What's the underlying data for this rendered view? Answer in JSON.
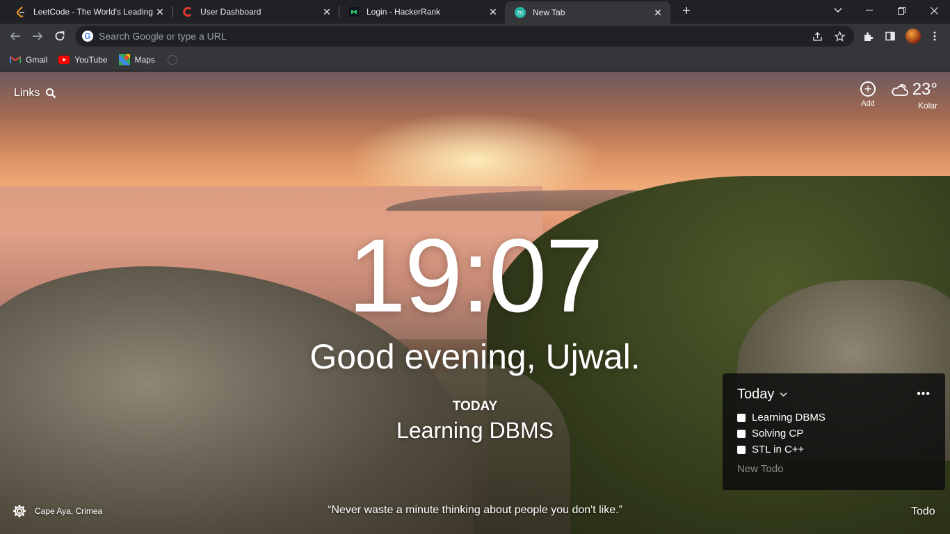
{
  "tabs": [
    {
      "title": "LeetCode - The World's Leading",
      "favicon": "leetcode-icon"
    },
    {
      "title": "User Dashboard",
      "favicon": "codechef-icon"
    },
    {
      "title": "Login - HackerRank",
      "favicon": "hackerrank-icon"
    },
    {
      "title": "New Tab",
      "favicon": "momentum-icon",
      "active": true
    }
  ],
  "omnibox": {
    "placeholder": "Search Google or type a URL"
  },
  "bookmarks": [
    {
      "label": "Gmail",
      "icon": "gmail-icon"
    },
    {
      "label": "YouTube",
      "icon": "youtube-icon"
    },
    {
      "label": "Maps",
      "icon": "maps-icon"
    }
  ],
  "dashboard": {
    "links_label": "Links",
    "add_label": "Add",
    "weather": {
      "temp": "23°",
      "location": "Kolar"
    },
    "clock": "19:07",
    "greeting": "Good evening, Ujwal.",
    "focus": {
      "label": "TODAY",
      "text": "Learning DBMS"
    },
    "photo_location": "Cape Aya, Crimea",
    "quote": "“Never waste a minute thinking about people you don't like.”",
    "todo_button": "Todo"
  },
  "todo": {
    "list_name": "Today",
    "items": [
      "Learning DBMS",
      "Solving CP",
      "STL in C++"
    ],
    "new_placeholder": "New Todo"
  },
  "colors": {
    "chrome_dark": "#202124",
    "toolbar": "#35363a",
    "accent_momentum": "#29b3a3"
  }
}
